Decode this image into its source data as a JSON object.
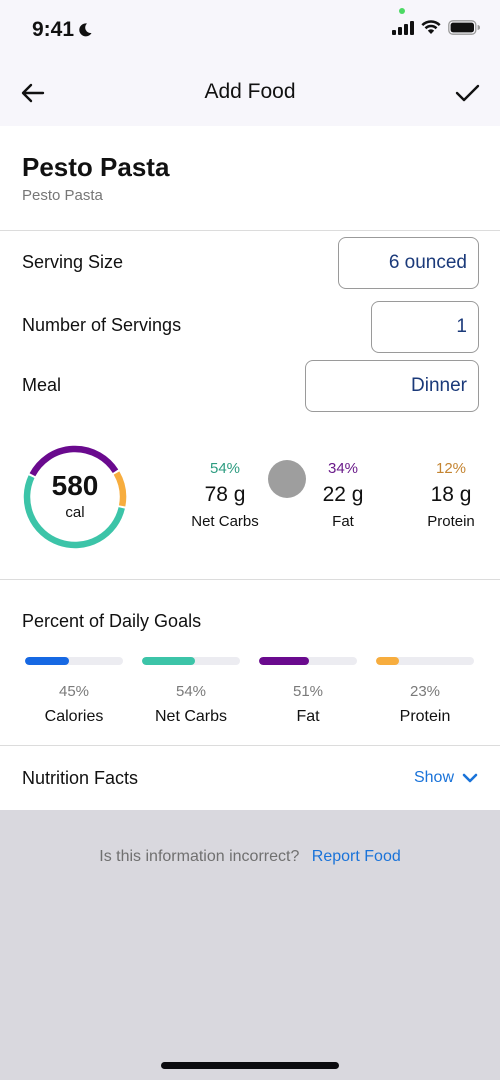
{
  "status_bar": {
    "time": "9:41",
    "focus_icon": "moon-icon",
    "icons": [
      "signal-icon",
      "wifi-icon",
      "battery-icon"
    ]
  },
  "nav": {
    "title": "Add Food",
    "back_icon": "arrow-left-icon",
    "confirm_icon": "checkmark-icon"
  },
  "food": {
    "name": "Pesto Pasta",
    "subtitle": "Pesto Pasta"
  },
  "fields": {
    "serving_size": {
      "label": "Serving Size",
      "value": "6 ounced"
    },
    "servings": {
      "label": "Number of Servings",
      "value": "1"
    },
    "meal": {
      "label": "Meal",
      "value": "Dinner"
    }
  },
  "summary": {
    "calories": "580",
    "calories_unit": "cal",
    "ring": {
      "carbs_fraction": 0.54,
      "fat_fraction": 0.34,
      "protein_fraction": 0.12
    },
    "macros": [
      {
        "pct": "54%",
        "grams": "78 g",
        "name": "Net Carbs",
        "color": "#2d9c80"
      },
      {
        "pct": "34%",
        "grams": "22 g",
        "name": "Fat",
        "color": "#6a1b8a"
      },
      {
        "pct": "12%",
        "grams": "18 g",
        "name": "Protein",
        "color": "#c48431"
      }
    ]
  },
  "goals": {
    "title": "Percent of Daily Goals",
    "items": [
      {
        "name": "Calories",
        "pct_label": "45%",
        "fraction": 0.45,
        "color": "#1668e3"
      },
      {
        "name": "Net Carbs",
        "pct_label": "54%",
        "fraction": 0.54,
        "color": "#3cc4a8"
      },
      {
        "name": "Fat",
        "pct_label": "51%",
        "fraction": 0.51,
        "color": "#6a0a8e"
      },
      {
        "name": "Protein",
        "pct_label": "23%",
        "fraction": 0.23,
        "color": "#f7ad3e"
      }
    ]
  },
  "nutrition_facts": {
    "title": "Nutrition Facts",
    "toggle_label": "Show",
    "toggle_icon": "chevron-down-icon"
  },
  "report": {
    "question": "Is this information incorrect?",
    "link": "Report Food"
  },
  "colors": {
    "carbs": "#3cc4a8",
    "fat": "#6a0a8e",
    "protein": "#f7ad3e",
    "link": "#1a73d9",
    "field_value": "#1b3a7a"
  }
}
